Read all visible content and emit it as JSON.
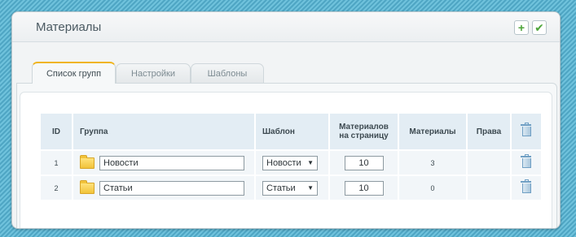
{
  "window": {
    "title": "Материалы"
  },
  "header_buttons": [
    {
      "name": "add",
      "icon": "plus-icon"
    },
    {
      "name": "apply",
      "icon": "check-icon"
    }
  ],
  "tabs": [
    {
      "label": "Список групп",
      "active": true
    },
    {
      "label": "Настройки",
      "active": false
    },
    {
      "label": "Шаблоны",
      "active": false
    }
  ],
  "table": {
    "headers": {
      "id": "ID",
      "group": "Группа",
      "template": "Шаблон",
      "per_page_line1": "Материалов",
      "per_page_line2": "на страницу",
      "materials": "Материалы",
      "rights": "Права"
    },
    "rows": [
      {
        "id": "1",
        "group": "Новости",
        "template": "Новости",
        "per_page": "10",
        "materials": "3"
      },
      {
        "id": "2",
        "group": "Статьи",
        "template": "Статьи",
        "per_page": "10",
        "materials": "0"
      }
    ]
  },
  "colors": {
    "accent_tab": "#f0b41c",
    "header_cell": "#e3edf4",
    "body_cell": "#f2f6f9"
  }
}
